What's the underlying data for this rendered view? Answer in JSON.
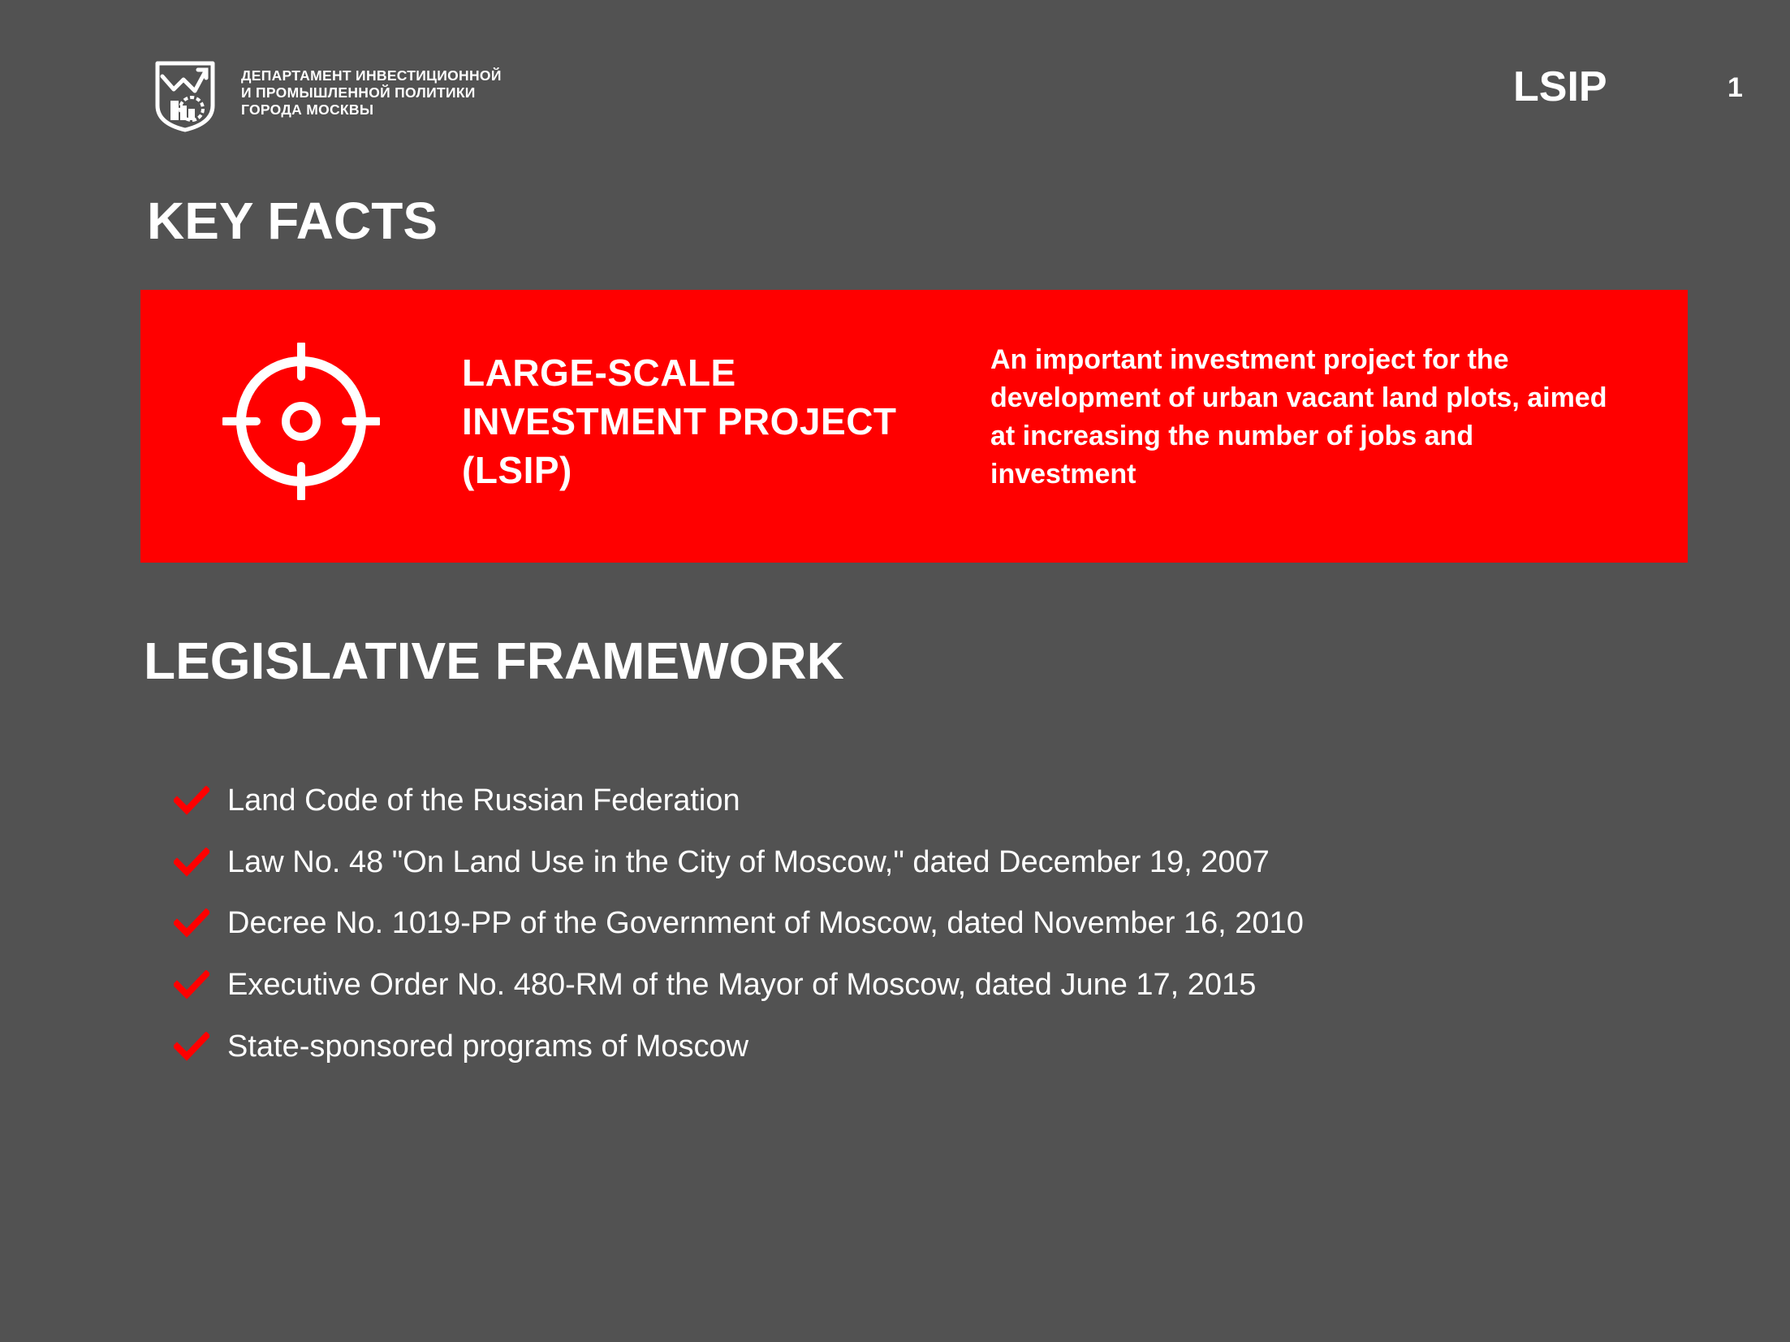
{
  "header": {
    "org_name_lines": [
      "ДЕПАРТАМЕНТ ИНВЕСТИЦИОННОЙ",
      "И ПРОМЫШЛЕННОЙ ПОЛИТИКИ",
      "ГОРОДА МОСКВЫ"
    ],
    "tag": "LSIP",
    "page_number": "1"
  },
  "key_facts": {
    "heading": "KEY FACTS",
    "project_title_lines": [
      "LARGE-SCALE",
      "INVESTMENT PROJECT",
      "(LSIP)"
    ],
    "description_lines": [
      "An important investment project for the",
      "development of urban vacant land plots, aimed",
      "at increasing the number of jobs and",
      "investment"
    ],
    "icon": "target-icon"
  },
  "legislative": {
    "heading": "LEGISLATIVE FRAMEWORK",
    "items": [
      "Land Code of the Russian Federation",
      "Law No. 48 \"On Land Use in the City of Moscow,\" dated December 19, 2007",
      "Decree No. 1019-PP of the Government of Moscow, dated November 16, 2010",
      "Executive Order No. 480-RM of the Mayor of Moscow, dated June 17, 2015",
      "State-sponsored programs of Moscow"
    ],
    "bullet_icon": "checkmark-icon"
  },
  "colors": {
    "background": "#525252",
    "accent": "#ff0000",
    "text": "#ffffff"
  }
}
